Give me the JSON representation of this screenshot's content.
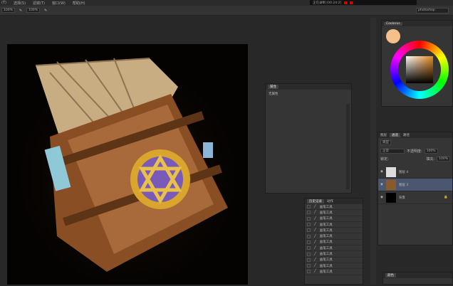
{
  "menu": [
    "(T)",
    "选择(S)",
    "滤镜(T)",
    "窗口(W)",
    "帮助(H)"
  ],
  "title": "正在录制 [00:24:2]",
  "options": {
    "flow": "100%",
    "opacity": "100%"
  },
  "workspace": "photoshop",
  "properties": {
    "tab": "属性",
    "text": "无属性"
  },
  "color_panel": {
    "tab": "Coolorus",
    "foreground": "#f6c08a",
    "accent": "#c9762a"
  },
  "layers": {
    "tabs": [
      "图层",
      "通道",
      "路径"
    ],
    "filter": "类型",
    "blend": "正常",
    "opacity_label": "不透明度:",
    "opacity": "100%",
    "lock_label": "锁定:",
    "fill_label": "填充:",
    "fill": "100%",
    "items": [
      {
        "name": "图层 4"
      },
      {
        "name": "图层 3"
      },
      {
        "name": "背景"
      }
    ]
  },
  "history": {
    "tabs": [
      "历史记录",
      "动作"
    ],
    "items": [
      "画笔工具",
      "画笔工具",
      "画笔工具",
      "画笔工具",
      "画笔工具",
      "画笔工具",
      "画笔工具",
      "画笔工具",
      "画笔工具",
      "画笔工具",
      "画笔工具",
      "画笔工具"
    ]
  },
  "swatches": {
    "tab": "颜色"
  }
}
